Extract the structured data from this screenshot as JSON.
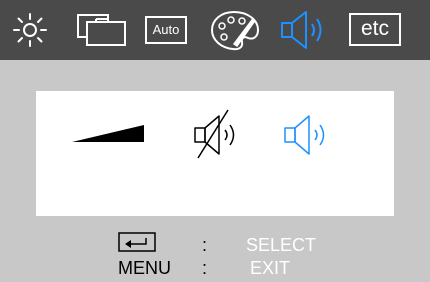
{
  "tabs": [
    {
      "id": "brightness",
      "icon": "sun-icon"
    },
    {
      "id": "image",
      "icon": "image-layers-icon"
    },
    {
      "id": "auto",
      "label": "Auto",
      "icon": "auto-box-icon"
    },
    {
      "id": "color",
      "icon": "palette-icon"
    },
    {
      "id": "audio",
      "icon": "speaker-icon",
      "selected": true
    },
    {
      "id": "etc",
      "label": "etc",
      "icon": "etc-box-icon"
    }
  ],
  "audio_panel": {
    "options": [
      {
        "id": "volume",
        "icon": "volume-ramp-icon"
      },
      {
        "id": "mute",
        "icon": "speaker-muted-icon"
      },
      {
        "id": "sound",
        "icon": "speaker-icon",
        "selected": true
      }
    ]
  },
  "help": {
    "select_separator": ":",
    "select_label": "SELECT",
    "menu_key": "MENU",
    "exit_separator": ":",
    "exit_label": "EXIT",
    "enter_icon": "enter-key-icon"
  },
  "colors": {
    "topbar": "#4a4a4a",
    "background": "#c8c8c8",
    "selected": "#1e90ff",
    "icon_fg": "#ffffff",
    "panel": "#ffffff"
  }
}
